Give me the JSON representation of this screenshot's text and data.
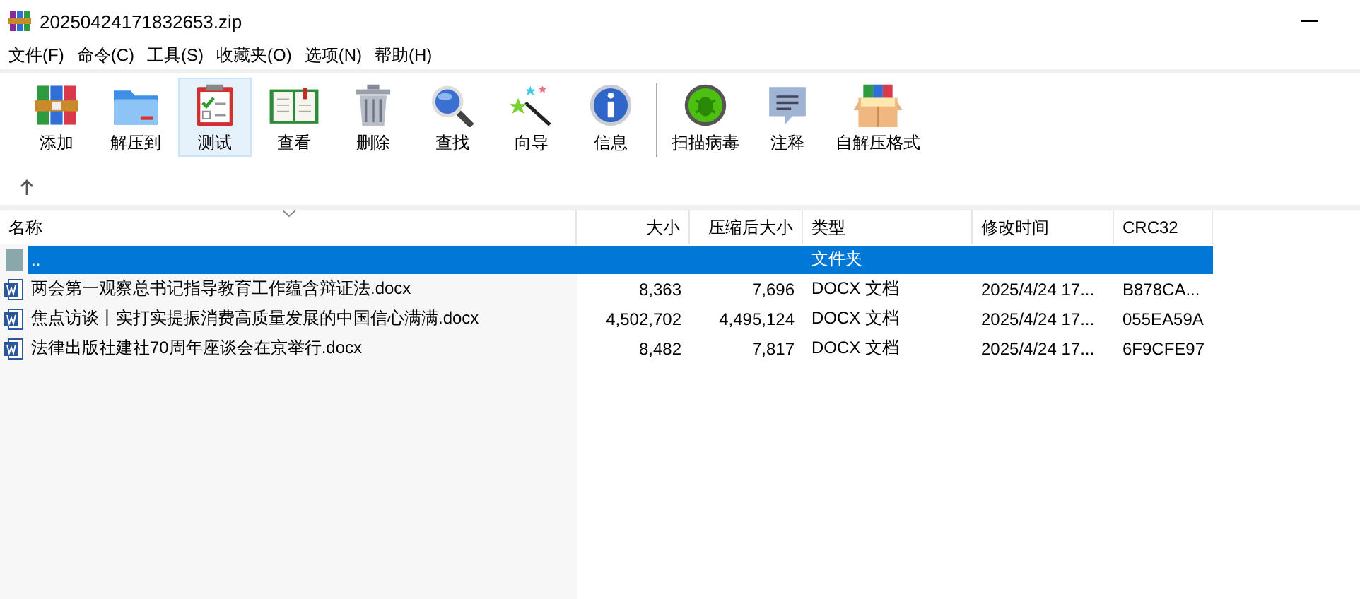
{
  "window": {
    "title": "20250424171832653.zip"
  },
  "menu": [
    "文件(F)",
    "命令(C)",
    "工具(S)",
    "收藏夹(O)",
    "选项(N)",
    "帮助(H)"
  ],
  "toolbar": {
    "groups": [
      [
        {
          "kind": "add",
          "label": "添加",
          "selected": false
        },
        {
          "kind": "extract",
          "label": "解压到",
          "selected": false
        },
        {
          "kind": "test",
          "label": "测试",
          "selected": true
        },
        {
          "kind": "view",
          "label": "查看",
          "selected": false
        },
        {
          "kind": "delete",
          "label": "删除",
          "selected": false
        },
        {
          "kind": "find",
          "label": "查找",
          "selected": false
        },
        {
          "kind": "wizard",
          "label": "向导",
          "selected": false
        },
        {
          "kind": "info",
          "label": "信息",
          "selected": false
        }
      ],
      [
        {
          "kind": "virus",
          "label": "扫描病毒",
          "selected": false
        },
        {
          "kind": "comment",
          "label": "注释",
          "selected": false
        },
        {
          "kind": "sfx",
          "label": "自解压格式",
          "selected": false
        }
      ]
    ]
  },
  "table": {
    "columns": [
      "名称",
      "大小",
      "压缩后大小",
      "类型",
      "修改时间",
      "CRC32"
    ],
    "rows": [
      {
        "kind": "parent",
        "selected": true,
        "name": "..",
        "type": "文件夹"
      },
      {
        "kind": "docx",
        "selected": false,
        "name": "两会第一观察总书记指导教育工作蕴含辩证法.docx",
        "size": "8,363",
        "packed": "7,696",
        "type": "DOCX 文档",
        "modified": "2025/4/24 17...",
        "crc": "B878CA..."
      },
      {
        "kind": "docx",
        "selected": false,
        "name": "焦点访谈丨实打实提振消费高质量发展的中国信心满满.docx",
        "size": "4,502,702",
        "packed": "4,495,124",
        "type": "DOCX 文档",
        "modified": "2025/4/24 17...",
        "crc": "055EA59A"
      },
      {
        "kind": "docx",
        "selected": false,
        "name": "法律出版社建社70周年座谈会在京举行.docx",
        "size": "8,482",
        "packed": "7,817",
        "type": "DOCX 文档",
        "modified": "2025/4/24 17...",
        "crc": "6F9CFE97"
      }
    ]
  }
}
